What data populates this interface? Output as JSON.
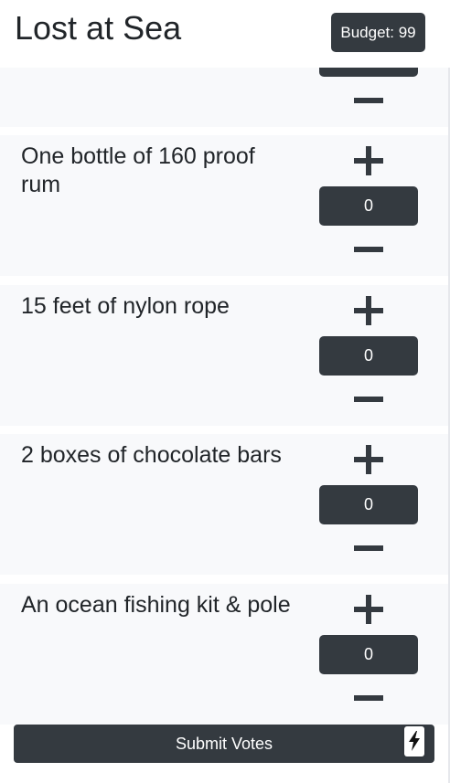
{
  "header": {
    "title": "Lost at Sea",
    "budget_label": "Budget: 99"
  },
  "items": [
    {
      "label": "",
      "votes": ""
    },
    {
      "label": "One bottle of 160 proof rum",
      "votes": "0"
    },
    {
      "label": "15 feet of nylon rope",
      "votes": "0"
    },
    {
      "label": "2 boxes of chocolate bars",
      "votes": "0"
    },
    {
      "label": "An ocean fishing kit & pole",
      "votes": "0"
    }
  ],
  "footer": {
    "submit_label": "Submit Votes"
  },
  "icons": {
    "plus": "plus-icon",
    "minus": "minus-icon",
    "bolt": "lightning-bolt-icon"
  },
  "colors": {
    "dark": "#343a40",
    "card_bg": "#f8f9fb",
    "text": "#212529"
  }
}
